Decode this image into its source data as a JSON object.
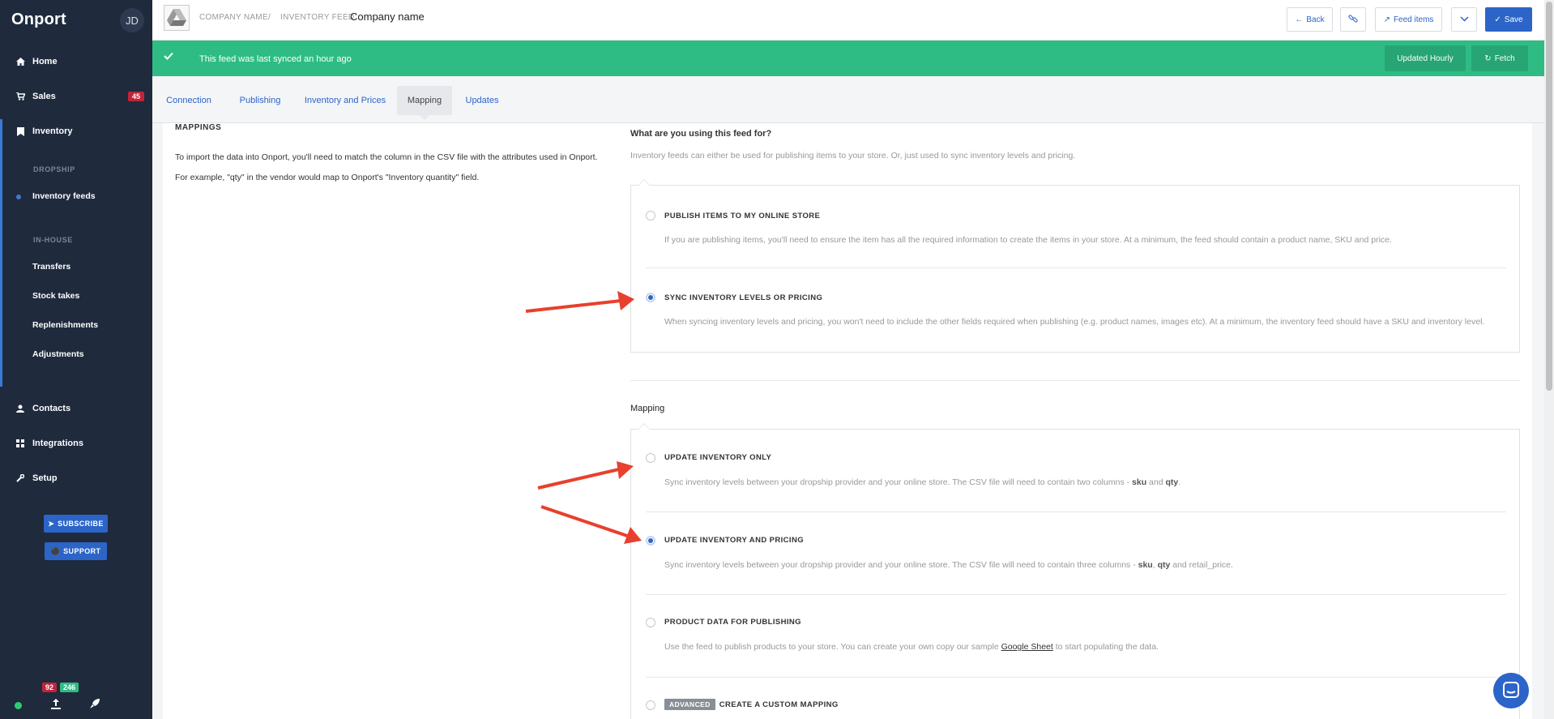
{
  "sidebar": {
    "logo": "Onport",
    "avatar": "JD",
    "items": [
      {
        "label": "Home",
        "icon": "home-icon"
      },
      {
        "label": "Sales",
        "icon": "cart-icon",
        "badge": "45"
      },
      {
        "label": "Inventory",
        "icon": "bookmark-icon"
      },
      {
        "label": "Contacts",
        "icon": "user-icon"
      },
      {
        "label": "Integrations",
        "icon": "grid-icon"
      },
      {
        "label": "Setup",
        "icon": "wrench-icon"
      }
    ],
    "dropship_heading": "DROPSHIP",
    "dropship_items": [
      "Inventory feeds"
    ],
    "inhouse_heading": "IN-HOUSE",
    "inhouse_items": [
      "Transfers",
      "Stock takes",
      "Replenishments",
      "Adjustments"
    ],
    "subscribe_label": "SUBSCRIBE",
    "support_label": "SUPPORT",
    "footer_badge_red": "92",
    "footer_badge_green": "246"
  },
  "header": {
    "crumb_company": "COMPANY NAME",
    "crumb_separator": "/",
    "crumb_feed": "INVENTORY FEED:",
    "title": "Company name",
    "back_label": "Back",
    "feed_items_label": "Feed items",
    "save_label": "Save"
  },
  "banner": {
    "text": "This feed was last synced an hour ago",
    "updated_label": "Updated Hourly",
    "fetch_label": "Fetch"
  },
  "tabs": [
    "Connection",
    "Publishing",
    "Inventory and Prices",
    "Mapping",
    "Updates"
  ],
  "active_tab": "Mapping",
  "left": {
    "heading": "MAPPINGS",
    "p1": "To import the data into Onport, you'll need to match the column in the CSV file with the attributes used in Onport.",
    "p2": "For example, \"qty\" in the vendor would map to Onport's \"Inventory quantity\" field."
  },
  "purpose": {
    "title": "What are you using this feed for?",
    "subtitle": "Inventory feeds can either be used for publishing items to your store. Or, just used to sync inventory levels and pricing.",
    "options": [
      {
        "label": "PUBLISH ITEMS TO MY ONLINE STORE",
        "desc": "If you are publishing items, you'll need to ensure the item has all the required information to create the items in your store. At a minimum, the feed should contain a product name, SKU and price.",
        "selected": false
      },
      {
        "label": "SYNC INVENTORY LEVELS OR PRICING",
        "desc": "When syncing inventory levels and pricing, you won't need to include the other fields required when publishing (e.g. product names, images etc). At a minimum, the inventory feed should have a SKU and inventory level.",
        "selected": true
      }
    ]
  },
  "mapping": {
    "title": "Mapping",
    "opt1": {
      "label": "UPDATE INVENTORY ONLY",
      "desc_pre": "Sync inventory levels between your dropship provider and your online store. The CSV file will need to contain two columns - ",
      "b1": "sku",
      "and": " and ",
      "b2": "qty",
      "end": ".",
      "selected": false
    },
    "opt2": {
      "label": "UPDATE INVENTORY AND PRICING",
      "desc_pre": "Sync inventory levels between your dropship provider and your online store. The CSV file will need to contain three columns - ",
      "b1": "sku",
      "comma": ", ",
      "b2": "qty",
      "and": " and retail_price.",
      "selected": true
    },
    "opt3": {
      "label": "PRODUCT DATA FOR PUBLISHING",
      "desc_pre": "Use the feed to publish products to your store. You can create your own copy our sample ",
      "link": "Google Sheet",
      "desc_post": " to start populating the data.",
      "selected": false
    },
    "opt4": {
      "badge": "ADVANCED",
      "label": "CREATE A CUSTOM MAPPING",
      "selected": false
    }
  },
  "colors": {
    "accent": "#2c64c8",
    "banner": "#2ebc84",
    "sidebar": "#1f2a3d",
    "arrow": "#e8402e",
    "badge_red": "#c0243a"
  }
}
